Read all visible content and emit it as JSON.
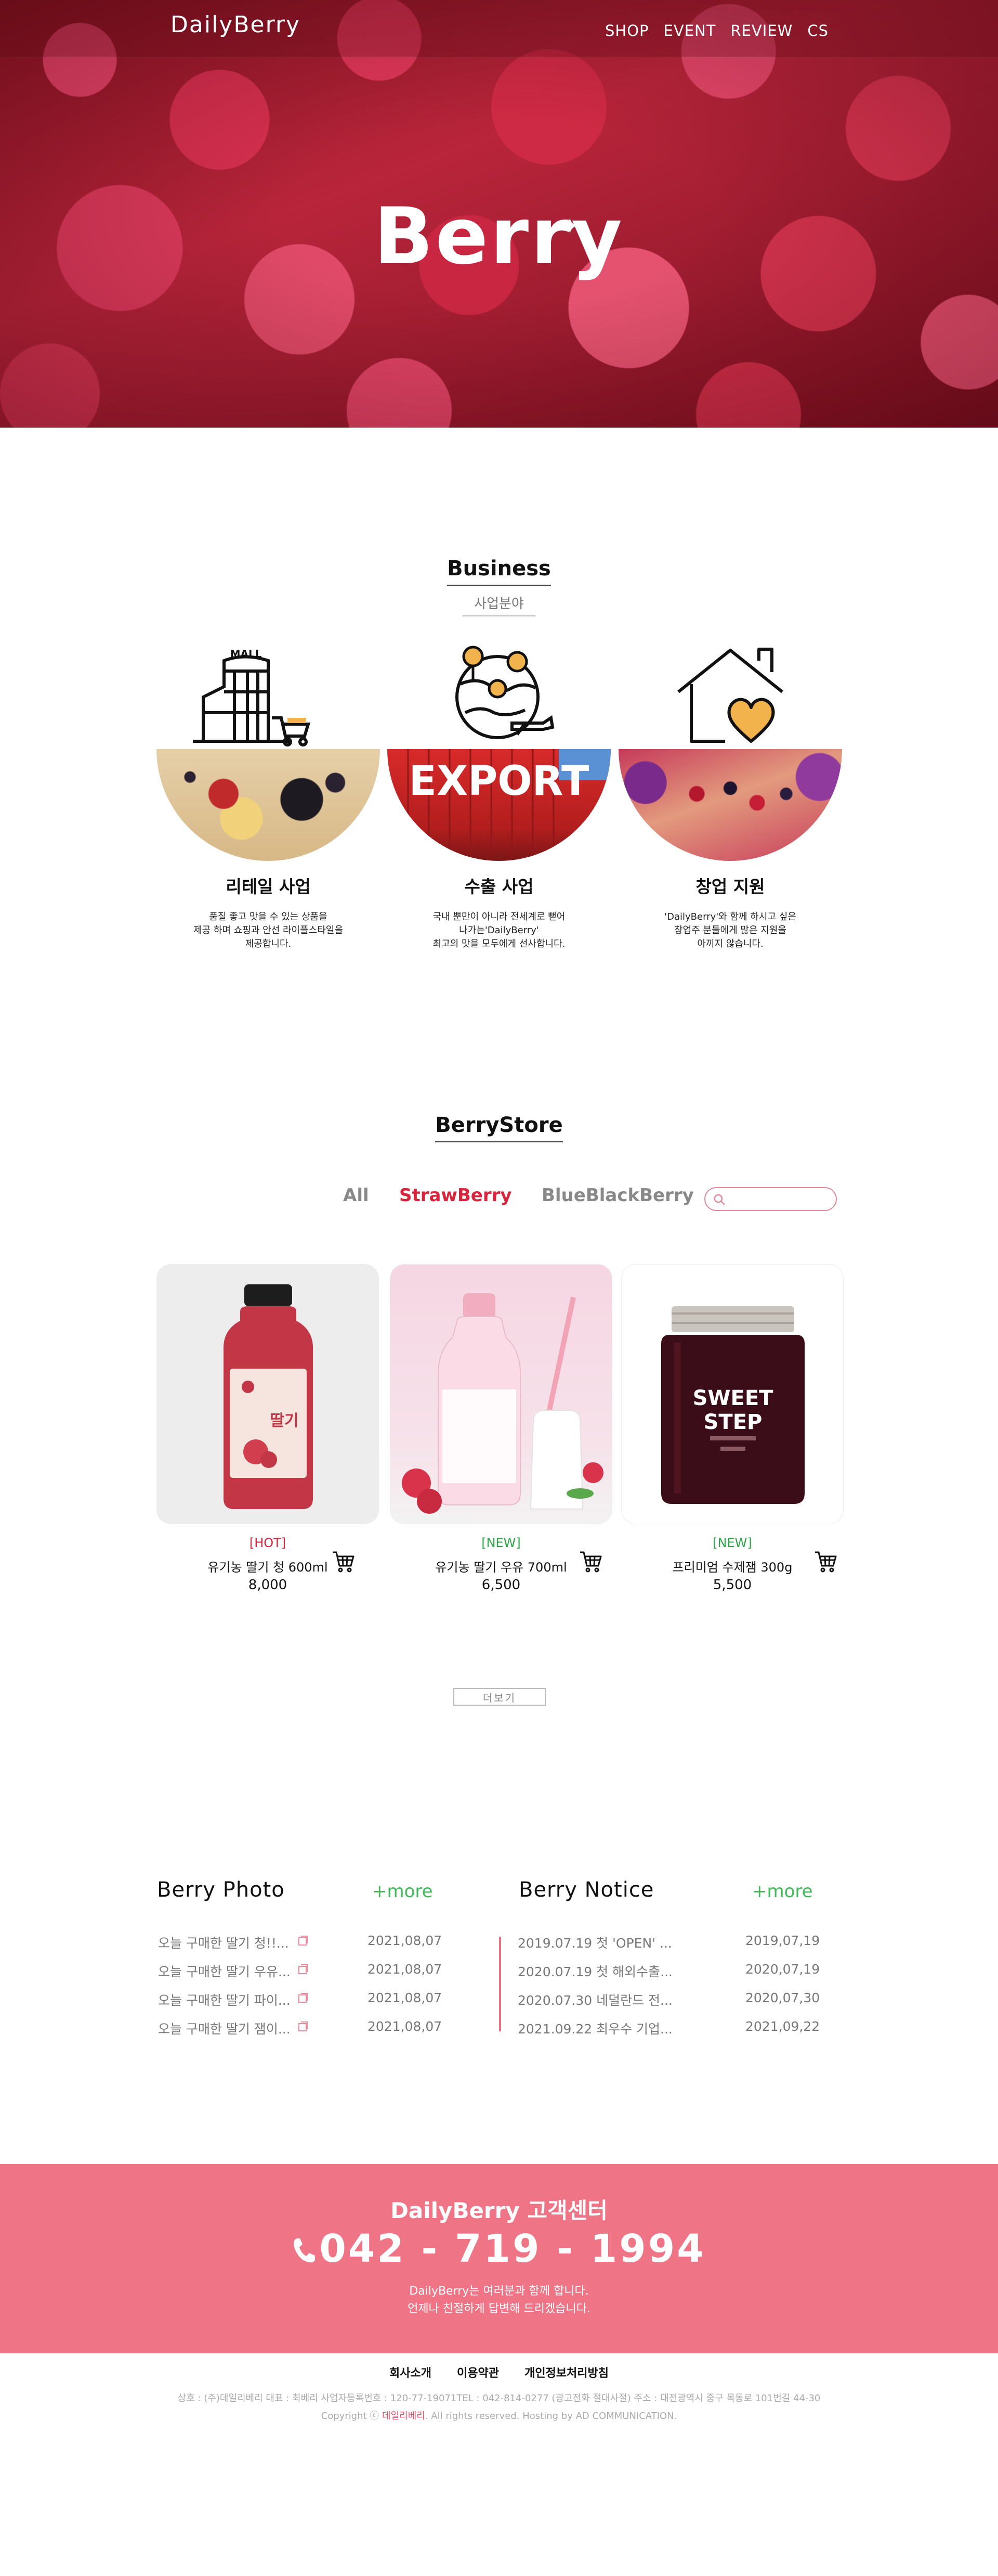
{
  "header": {
    "logo": "DailyBerry",
    "nav": [
      "SHOP",
      "EVENT",
      "REVIEW",
      "CS"
    ]
  },
  "hero": {
    "title": "Berry"
  },
  "business": {
    "title": "Business",
    "subtitle": "사업분야",
    "cards": [
      {
        "icon": "mall-icon",
        "mall_text": "MALL",
        "label": "리테일 사업",
        "desc": [
          "품질 좋고 맛을 수 있는 상품을",
          "제공 하며 쇼핑과 안선 라이플스타일을",
          "제공합니다."
        ]
      },
      {
        "icon": "globe-pin-plane-icon",
        "photo_text": "EXPORT",
        "label": "수출 사업",
        "desc": [
          "국내 뿐만이 아니라 전세계로 뻗어",
          "나가는'DailyBerry'",
          "최고의 맛을 모두에게 선사합니다."
        ]
      },
      {
        "icon": "house-heart-icon",
        "label": "창업 지원",
        "desc": [
          "'DailyBerry'와 함께 하시고 싶은",
          "창업주 분들에게 많은 지원을",
          "아끼지 않습니다."
        ]
      }
    ]
  },
  "store": {
    "title": "BerryStore",
    "filters": [
      "All",
      "StrawBerry",
      "BlueBlackBerry"
    ],
    "active_filter": "StrawBerry",
    "search": {
      "value": "",
      "placeholder": ""
    },
    "products": [
      {
        "badge": "[HOT]",
        "badge_type": "hot",
        "name": "유기농 딸기 청 600ml",
        "price": "8,000",
        "label_text": "딸기"
      },
      {
        "badge": "[NEW]",
        "badge_type": "new",
        "name": "유기농 딸기 우유 700ml",
        "price": "6,500"
      },
      {
        "badge": "[NEW]",
        "badge_type": "new",
        "name": "프리미엄 수제잼 300g",
        "price": "5,500",
        "jar_text1": "SWEET",
        "jar_text2": "STEP"
      }
    ],
    "more_label": "더보기"
  },
  "photo_board": {
    "title": "Berry Photo",
    "more": "+more",
    "rows": [
      {
        "title": "오늘 구매한 딸기 청!!...",
        "date": "2021,08,07"
      },
      {
        "title": "오늘 구매한 딸기 우유...",
        "date": "2021,08,07"
      },
      {
        "title": "오늘 구매한 딸기 파이...",
        "date": "2021,08,07"
      },
      {
        "title": "오늘 구매한 딸기 잼이...",
        "date": "2021,08,07"
      }
    ]
  },
  "notice_board": {
    "title": "Berry Notice",
    "more": "+more",
    "rows": [
      {
        "title": "2019.07.19 첫 'OPEN' ...",
        "date": "2019,07,19"
      },
      {
        "title": "2020.07.19 첫 해외수출...",
        "date": "2020,07,19"
      },
      {
        "title": "2020.07.30 네덜란드 전...",
        "date": "2020,07,30"
      },
      {
        "title": "2021.09.22 최우수 기업...",
        "date": "2021,09,22"
      }
    ]
  },
  "cs": {
    "title": "DailyBerry 고객센터",
    "phone": "042 - 719 - 1994",
    "line1": "DailyBerry는 여러분과 함께 합니다.",
    "line2": "언제나 친절하게 답변해 드리겠습니다."
  },
  "footer": {
    "links": [
      "회사소개",
      "이용약관",
      "개인정보처리방침"
    ],
    "info": "상호 : (주)데일리베리 대표 : 최베리 사업자등록번호 : 120-77-19071TEL : 042-814-0277 (광고전화 절대사절) 주소 : 대전광역시 중구 목동로 101번길 44-30",
    "copy_prefix": "Copyright ⓒ ",
    "copy_brand": "데일리베리",
    "copy_suffix": ". All rights reserved. Hosting by AD COMMUNICATION."
  },
  "colors": {
    "accent": "#ef7486",
    "red": "#d6253c",
    "green": "#3fbb59"
  }
}
